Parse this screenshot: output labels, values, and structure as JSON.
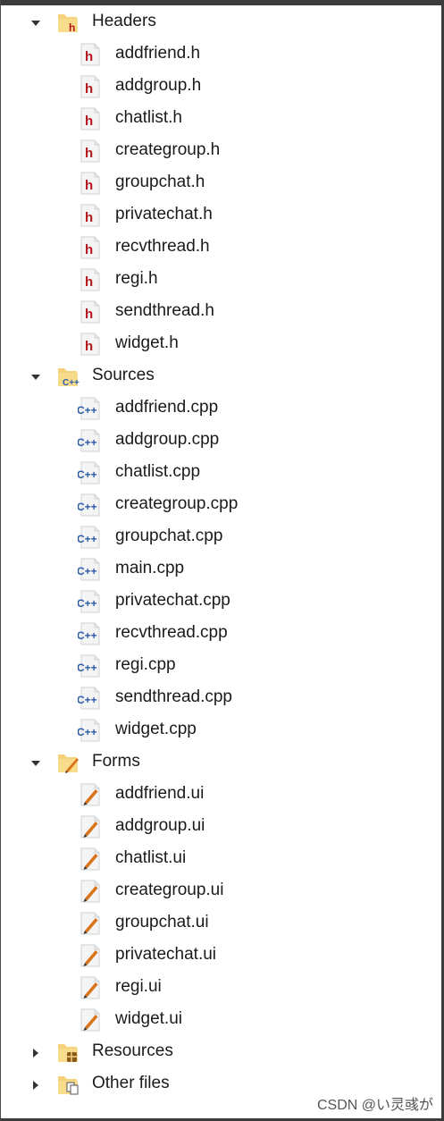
{
  "groups": [
    {
      "label": "Headers",
      "expanded": true,
      "icon": "folder-header-icon",
      "files": [
        "addfriend.h",
        "addgroup.h",
        "chatlist.h",
        "creategroup.h",
        "groupchat.h",
        "privatechat.h",
        "recvthread.h",
        "regi.h",
        "sendthread.h",
        "widget.h"
      ],
      "file_icon": "header-file-icon"
    },
    {
      "label": "Sources",
      "expanded": true,
      "icon": "folder-cpp-icon",
      "files": [
        "addfriend.cpp",
        "addgroup.cpp",
        "chatlist.cpp",
        "creategroup.cpp",
        "groupchat.cpp",
        "main.cpp",
        "privatechat.cpp",
        "recvthread.cpp",
        "regi.cpp",
        "sendthread.cpp",
        "widget.cpp"
      ],
      "file_icon": "cpp-file-icon"
    },
    {
      "label": "Forms",
      "expanded": true,
      "icon": "folder-forms-icon",
      "files": [
        "addfriend.ui",
        "addgroup.ui",
        "chatlist.ui",
        "creategroup.ui",
        "groupchat.ui",
        "privatechat.ui",
        "regi.ui",
        "widget.ui"
      ],
      "file_icon": "ui-file-icon"
    },
    {
      "label": "Resources",
      "expanded": false,
      "icon": "folder-resources-icon",
      "files": [],
      "file_icon": ""
    },
    {
      "label": "Other files",
      "expanded": false,
      "icon": "folder-other-icon",
      "files": [],
      "file_icon": ""
    }
  ],
  "watermark": "CSDN @い灵彧が"
}
